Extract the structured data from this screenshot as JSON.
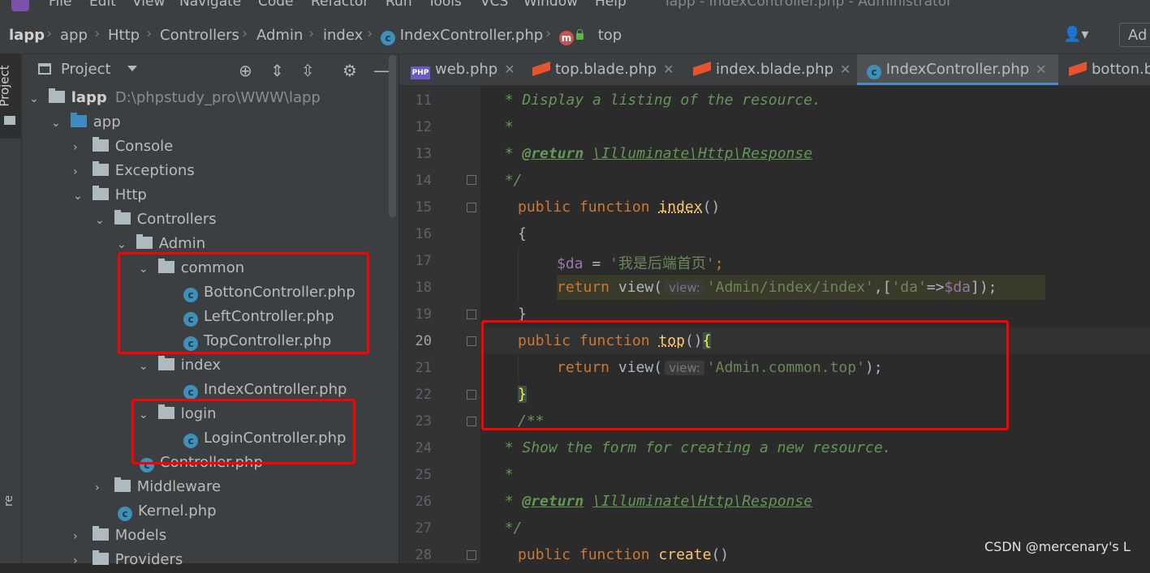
{
  "menubar": {
    "items": [
      "File",
      "Edit",
      "View",
      "Navigate",
      "Code",
      "Refactor",
      "Run",
      "Tools",
      "VCS",
      "Window",
      "Help"
    ],
    "window_title": "lapp - IndexController.php - Administrator"
  },
  "breadcrumb": {
    "items": [
      "lapp",
      "app",
      "Http",
      "Controllers",
      "Admin",
      "index",
      "IndexController.php",
      "top"
    ],
    "user_icon": "user-icon",
    "add_config_label": "Ad"
  },
  "leftstrip": {
    "project_label": "Project",
    "bottom_label": "re"
  },
  "project_panel": {
    "title": "Project",
    "tools": [
      "crosshair-icon",
      "expand-icon",
      "collapse-icon",
      "gear-icon",
      "minimize-icon"
    ],
    "tree": [
      {
        "label": "lapp",
        "path": "D:\\phpstudy_pro\\WWW\\lapp",
        "type": "folder",
        "expanded": true,
        "bold": true
      },
      {
        "label": "app",
        "type": "folder",
        "expanded": true,
        "blue": true
      },
      {
        "label": "Console",
        "type": "folder",
        "expanded": false
      },
      {
        "label": "Exceptions",
        "type": "folder",
        "expanded": false
      },
      {
        "label": "Http",
        "type": "folder",
        "expanded": true
      },
      {
        "label": "Controllers",
        "type": "folder",
        "expanded": true
      },
      {
        "label": "Admin",
        "type": "folder",
        "expanded": true
      },
      {
        "label": "common",
        "type": "folder",
        "expanded": true
      },
      {
        "label": "BottonController.php",
        "type": "class"
      },
      {
        "label": "LeftController.php",
        "type": "class"
      },
      {
        "label": "TopController.php",
        "type": "class"
      },
      {
        "label": "index",
        "type": "folder",
        "expanded": true
      },
      {
        "label": "IndexController.php",
        "type": "class"
      },
      {
        "label": "login",
        "type": "folder",
        "expanded": true
      },
      {
        "label": "LoginController.php",
        "type": "class"
      },
      {
        "label": "Controller.php",
        "type": "class"
      },
      {
        "label": "Middleware",
        "type": "folder",
        "expanded": false
      },
      {
        "label": "Kernel.php",
        "type": "class"
      },
      {
        "label": "Models",
        "type": "folder",
        "expanded": false
      },
      {
        "label": "Providers",
        "type": "folder",
        "expanded": false
      }
    ]
  },
  "tabs": [
    {
      "label": "web.php",
      "icon": "php-file-icon",
      "active": false
    },
    {
      "label": "top.blade.php",
      "icon": "blade-file-icon",
      "active": false
    },
    {
      "label": "index.blade.php",
      "icon": "blade-file-icon",
      "active": false
    },
    {
      "label": "IndexController.php",
      "icon": "class-file-icon",
      "active": true
    },
    {
      "label": "botton.b",
      "icon": "blade-file-icon",
      "active": false
    }
  ],
  "editor": {
    "current_line": 20,
    "lines": [
      {
        "n": "11",
        "text": " * Display a listing of the resource."
      },
      {
        "n": "12",
        "text": " *"
      },
      {
        "n": "13",
        "text": " * @return \\Illuminate\\Http\\Response"
      },
      {
        "n": "14",
        "text": " */"
      },
      {
        "n": "15",
        "text": "public function index()"
      },
      {
        "n": "16",
        "text": "{"
      },
      {
        "n": "17",
        "text": "$da = '我是后端首页';"
      },
      {
        "n": "18",
        "text": "return view( view: 'Admin/index/index',['da'=>$da]);"
      },
      {
        "n": "19",
        "text": "}"
      },
      {
        "n": "20",
        "text": "public function top(){"
      },
      {
        "n": "21",
        "text": "return view( view: 'Admin.common.top');"
      },
      {
        "n": "22",
        "text": "}"
      },
      {
        "n": "23",
        "text": "/**"
      },
      {
        "n": "24",
        "text": " * Show the form for creating a new resource."
      },
      {
        "n": "25",
        "text": " *"
      },
      {
        "n": "26",
        "text": " * @return \\Illuminate\\Http\\Response"
      },
      {
        "n": "27",
        "text": " */"
      },
      {
        "n": "28",
        "text": "public function create()"
      }
    ],
    "tokens": {
      "doc_display": "* Display a listing of the resource.",
      "star": "*",
      "return_tag": "@return",
      "resp_pre": "\\",
      "illuminate": "Illuminate",
      "http": "Http",
      "response": "Response",
      "bs": "\\",
      "doc_end": "*/",
      "public": "public",
      "function": "function",
      "index_fn": "index",
      "parens": "()",
      "open_brace": "{",
      "close_brace": "}",
      "da_var": "$da",
      "assign": " = ",
      "da_str": "'我是后端首页'",
      "semi": ";",
      "return": "return",
      "view_call": "view(",
      "hint_view": "view:",
      "admin_index_str": "'Admin/index/index'",
      "arr_open": ",[",
      "da_key": "'da'",
      "arrow": "=>",
      "arr_close": "]);",
      "top_fn": "top",
      "paren_open": "(",
      "paren_close": ")",
      "common_top_str": "'Admin.common.top'",
      "close_call": ");",
      "doc_start": "/**",
      "doc_show": "* Show the form for creating a new resource.",
      "create_fn": "create"
    }
  },
  "watermark": "CSDN @mercenary's L",
  "colors": {
    "annotation_box": "#ff0000",
    "active_tab_underline": "#4a88c7"
  }
}
